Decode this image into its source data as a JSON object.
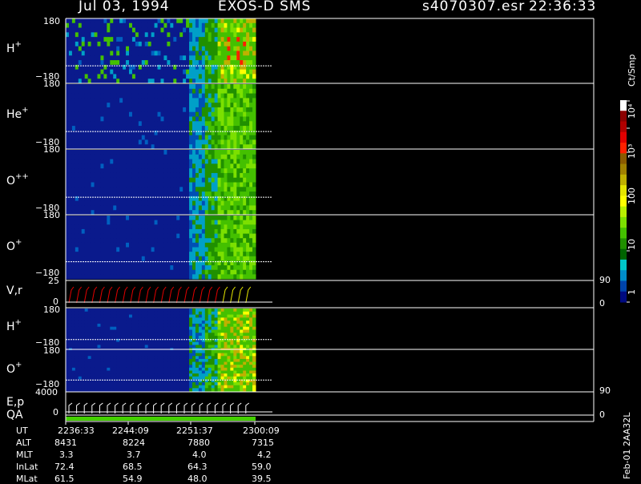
{
  "header": {
    "date": "Jul 03, 1994",
    "mission": "EXOS-D SMS",
    "file": "s4070307.esr",
    "time": "22:36:33"
  },
  "colorbar": {
    "unit": "Ct/Smp",
    "labels": [
      "10⁴",
      "10³",
      "100",
      "10",
      "1"
    ],
    "colors": [
      "#ffffff",
      "#8b0000",
      "#b00000",
      "#e00000",
      "#ff2000",
      "#8a5a00",
      "#a08000",
      "#c0b000",
      "#e6e600",
      "#ffff00",
      "#b8f000",
      "#7ce000",
      "#44c000",
      "#209000",
      "#006400",
      "#00c8c8",
      "#008cc8",
      "#0044aa",
      "#000a80"
    ]
  },
  "panels": [
    {
      "label_main": "H",
      "label_sup": "+",
      "ymax": "180",
      "ymin": "−180"
    },
    {
      "label_main": "He",
      "label_sup": "+",
      "ymax": "180",
      "ymin": "−180"
    },
    {
      "label_main": "O",
      "label_sup": "++",
      "ymax": "180",
      "ymin": "−180"
    },
    {
      "label_main": "O",
      "label_sup": "+",
      "ymax": "180",
      "ymin": "−180"
    },
    {
      "label_main": "V,r",
      "label_sup": "",
      "ymax": "25",
      "ymin": "0",
      "rmax": "90",
      "rmin": "0"
    },
    {
      "label_main": "H",
      "label_sup": "+",
      "ymax": "180",
      "ymin": "−180"
    },
    {
      "label_main": "O",
      "label_sup": "+",
      "ymax": "180",
      "ymin": "−180"
    },
    {
      "label_main": "E,p",
      "label_sup": "",
      "ymax": "4000",
      "ymin": "0",
      "rmax": "90",
      "rmin": "0"
    },
    {
      "label_main": "QA",
      "label_sup": ""
    }
  ],
  "ephemeris": {
    "rows": [
      {
        "label": "UT",
        "values": [
          "2236:33",
          "2244:09",
          "2251:37",
          "2300:09"
        ]
      },
      {
        "label": "ALT",
        "values": [
          "8431",
          "8224",
          "7880",
          "7315"
        ]
      },
      {
        "label": "MLT",
        "values": [
          "3.3",
          "3.7",
          "4.0",
          "4.2"
        ]
      },
      {
        "label": "InLat",
        "values": [
          "72.4",
          "68.5",
          "64.3",
          "59.0"
        ]
      },
      {
        "label": "MLat",
        "values": [
          "61.5",
          "54.9",
          "48.0",
          "39.5"
        ]
      }
    ]
  },
  "footer_vertical": "Feb-01 2AA32L",
  "chart_data": {
    "type": "heatmap",
    "title": "Jul 03, 1994 EXOS-D SMS",
    "x_ticks": [
      "2236:33",
      "2244:09",
      "2251:37",
      "2300:09"
    ],
    "panels": [
      {
        "name": "H+",
        "ylim": [
          -180,
          180
        ]
      },
      {
        "name": "He+",
        "ylim": [
          -180,
          180
        ]
      },
      {
        "name": "O++",
        "ylim": [
          -180,
          180
        ]
      },
      {
        "name": "O+",
        "ylim": [
          -180,
          180
        ]
      },
      {
        "name": "V,r",
        "ylim": [
          0,
          25
        ],
        "rlim": [
          0,
          90
        ]
      },
      {
        "name": "H+",
        "ylim": [
          -180,
          180
        ]
      },
      {
        "name": "O+",
        "ylim": [
          -180,
          180
        ]
      },
      {
        "name": "E,p",
        "ylim": [
          0,
          4000
        ],
        "rlim": [
          0,
          90
        ]
      },
      {
        "name": "QA"
      }
    ],
    "colorscale": {
      "label": "Ct/Smp",
      "log": true,
      "range": [
        1,
        10000
      ]
    }
  }
}
